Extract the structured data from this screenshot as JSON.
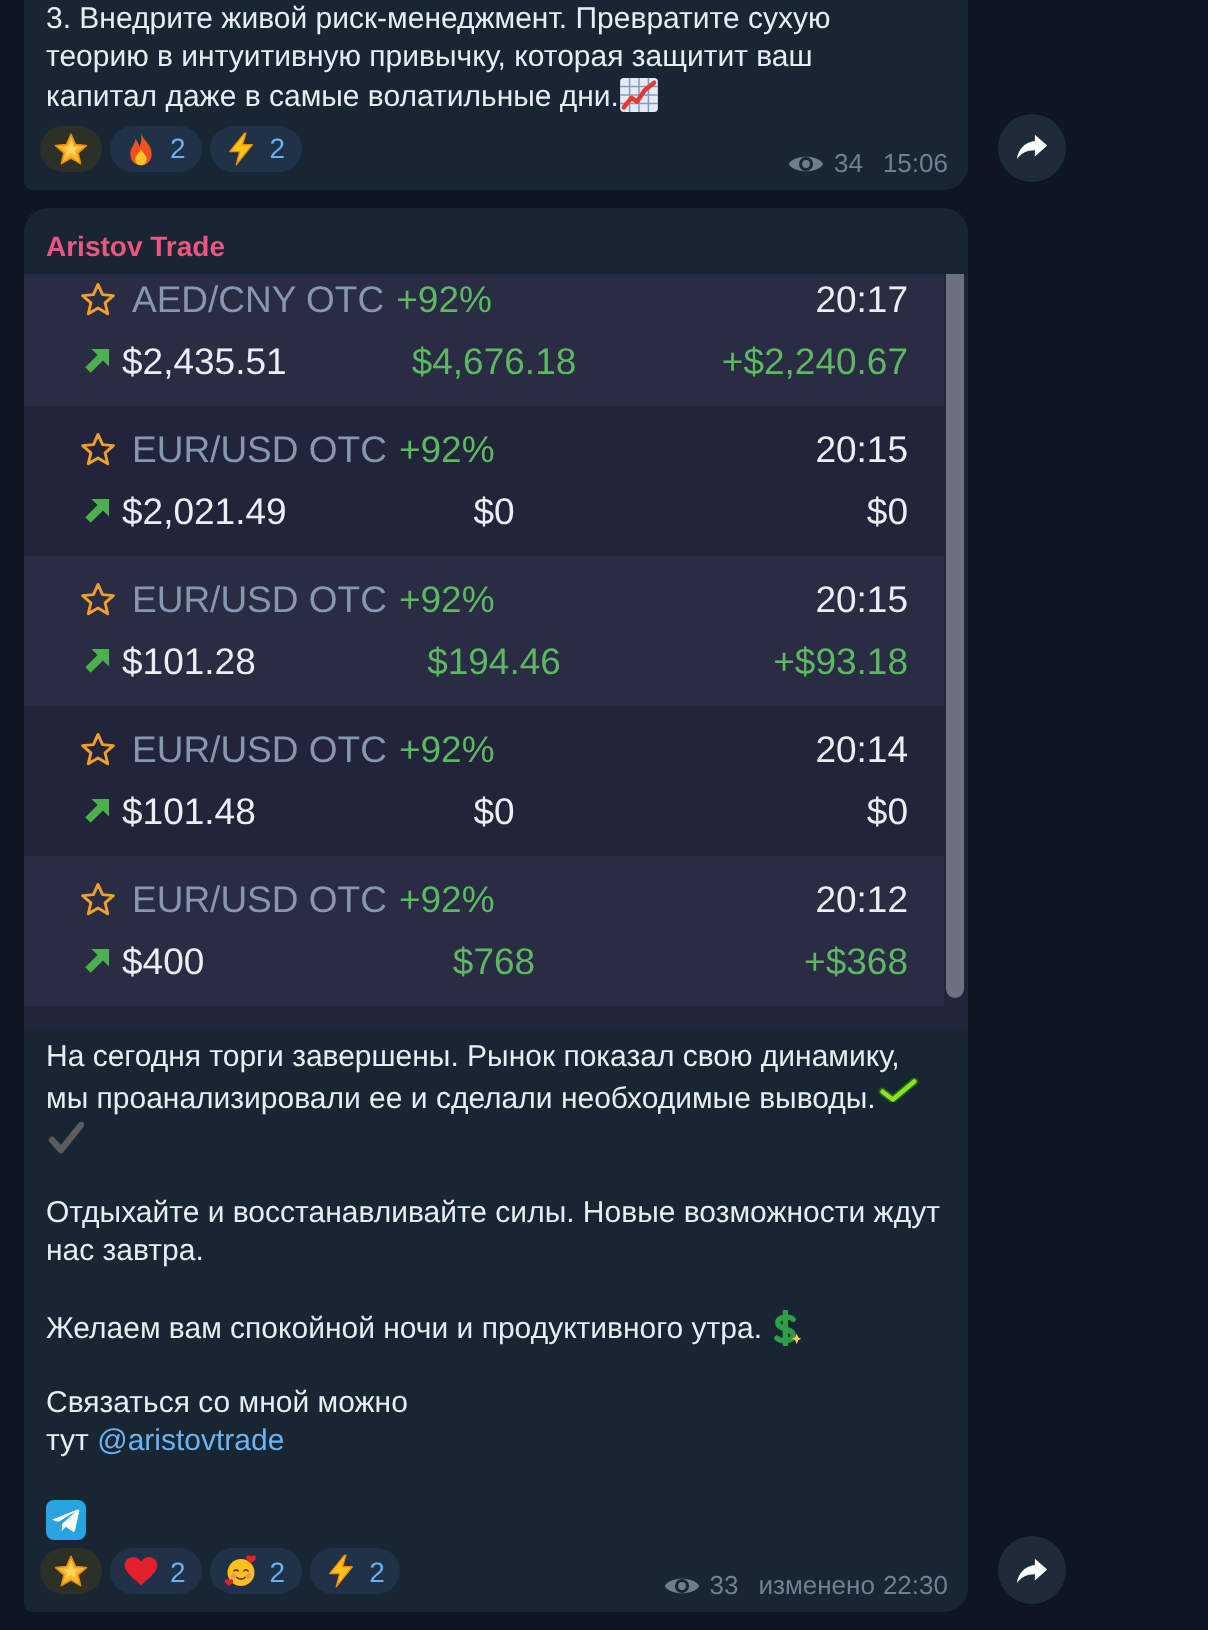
{
  "messages": [
    {
      "body": [
        {
          "lines": [
            "3. Внедрите живой риск-менеджмент. Превратите сухую",
            "теорию в интуитивную привычку, которая защитит ваш",
            "капитал даже в самые волатильные дни."
          ],
          "emoji": [
            {
              "kind": "chart"
            }
          ]
        }
      ],
      "reactions": [
        {
          "kind": "star"
        },
        {
          "kind": "fire",
          "count": "2"
        },
        {
          "kind": "zap",
          "count": "2"
        }
      ],
      "views": "34",
      "time": "15:06"
    },
    {
      "author": "Aristov Trade",
      "trades": [
        {
          "favorite": false,
          "pair": "AED/CNY OTC",
          "payout": "+92%",
          "time": "20:17",
          "rising": true,
          "amount_1": "$2,435.51",
          "amount_2": "$4,676.18",
          "amount_3": "+$2,240.67",
          "win": true
        },
        {
          "favorite": false,
          "pair": "EUR/USD OTC",
          "payout": "+92%",
          "time": "20:15",
          "rising": true,
          "amount_1": "$2,021.49",
          "amount_2": "$0",
          "amount_3": "$0",
          "win": false
        },
        {
          "favorite": false,
          "pair": "EUR/USD OTC",
          "payout": "+92%",
          "time": "20:15",
          "rising": true,
          "amount_1": "$101.28",
          "amount_2": "$194.46",
          "amount_3": "+$93.18",
          "win": true
        },
        {
          "favorite": false,
          "pair": "EUR/USD OTC",
          "payout": "+92%",
          "time": "20:14",
          "rising": true,
          "amount_1": "$101.48",
          "amount_2": "$0",
          "amount_3": "$0",
          "win": false
        },
        {
          "favorite": false,
          "pair": "EUR/USD OTC",
          "payout": "+92%",
          "time": "20:12",
          "rising": true,
          "amount_1": "$400",
          "amount_2": "$768",
          "amount_3": "+$368",
          "win": true
        }
      ],
      "body": [
        {
          "lines": [
            "На сегодня торги завершены. Рынок показал свою динамику,",
            "мы проанализировали ее и сделали необходимые выводы."
          ],
          "emoji": [
            {
              "kind": "tick"
            },
            {
              "kind": "heavy-check"
            }
          ]
        },
        {
          "lines": [
            "Отдыхайте и восстанавливайте силы. Новые возможности ждут",
            "нас завтра."
          ]
        },
        {
          "lines": [
            "Желаем вам спокойной ночи и продуктивного утра."
          ],
          "emoji": [
            {
              "kind": "dollar"
            }
          ]
        },
        {
          "lines": [
            "Связаться со мной можно",
            "тут"
          ],
          "link": "@aristovtrade"
        },
        {
          "emoji": [
            {
              "kind": "telegram"
            }
          ]
        }
      ],
      "reactions": [
        {
          "kind": "star"
        },
        {
          "kind": "heart",
          "count": "2"
        },
        {
          "kind": "smiling-hearts",
          "count": "2"
        },
        {
          "kind": "zap",
          "count": "2"
        }
      ],
      "views": "33",
      "edited": "изменено",
      "time": "22:30"
    }
  ]
}
